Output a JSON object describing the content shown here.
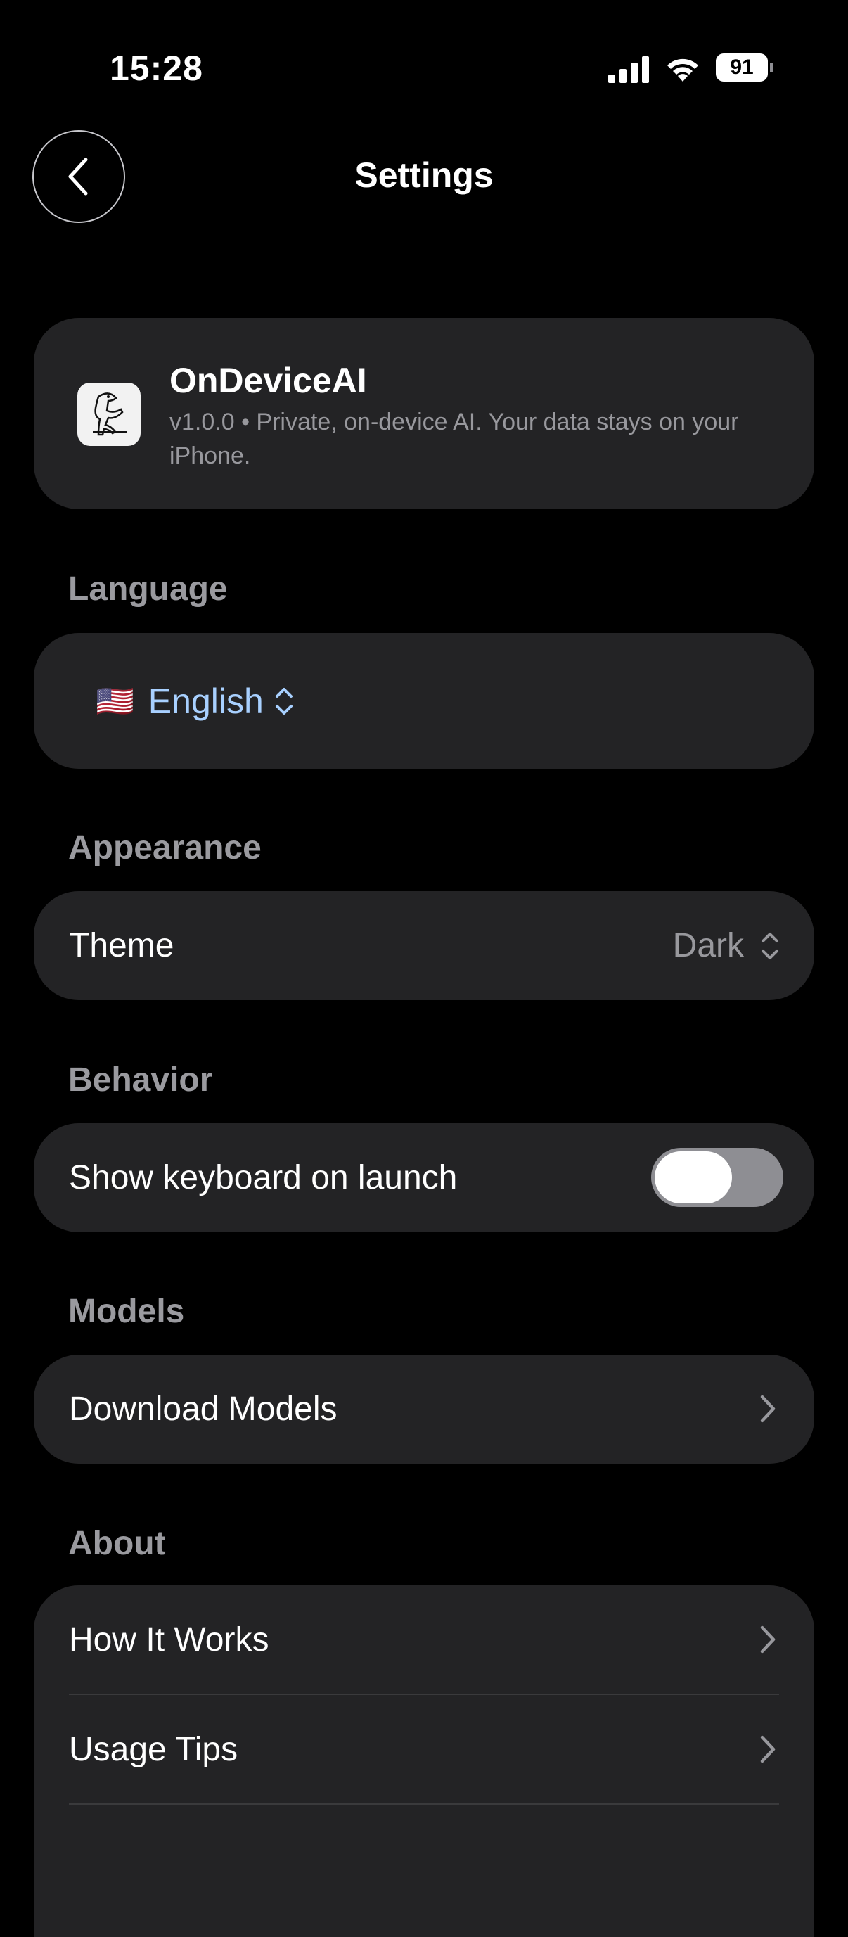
{
  "status_bar": {
    "time": "15:28",
    "battery": "91"
  },
  "header": {
    "title": "Settings"
  },
  "app_info": {
    "name": "OnDeviceAI",
    "description": "v1.0.0 • Private, on-device AI. Your data stays on your iPhone."
  },
  "language": {
    "header": "Language",
    "flag": "🇺🇸",
    "value": "English"
  },
  "appearance": {
    "header": "Appearance",
    "theme_label": "Theme",
    "theme_value": "Dark"
  },
  "behavior": {
    "header": "Behavior",
    "keyboard_label": "Show keyboard on launch",
    "keyboard_enabled": false
  },
  "models": {
    "header": "Models",
    "download_label": "Download Models"
  },
  "about": {
    "header": "About",
    "items": [
      {
        "label": "How It Works"
      },
      {
        "label": "Usage Tips"
      }
    ]
  }
}
